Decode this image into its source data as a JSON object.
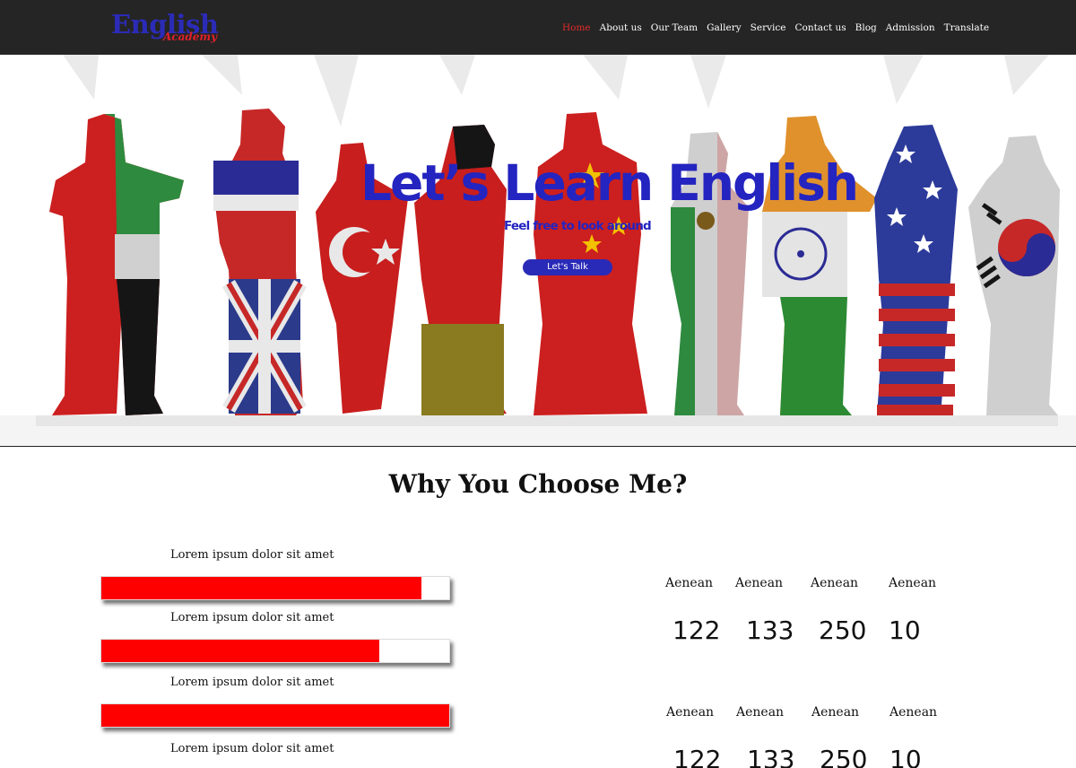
{
  "header": {
    "logo_main": "English",
    "logo_sub": "Academy",
    "nav": [
      {
        "label": "Home",
        "active": true
      },
      {
        "label": "About us"
      },
      {
        "label": "Our Team"
      },
      {
        "label": "Gallery"
      },
      {
        "label": "Service"
      },
      {
        "label": "Contact us"
      },
      {
        "label": "Blog"
      },
      {
        "label": "Admission"
      },
      {
        "label": "Translate"
      }
    ],
    "colors": {
      "bar": "#252525",
      "active": "#e22a2a",
      "logo": "#2b2bb8"
    }
  },
  "hero": {
    "title": "Let’s Learn English",
    "subtitle": "Feel free to look around",
    "cta_label": "Let's Talk",
    "image": "people-in-national-flag-silhouettes"
  },
  "section": {
    "title": "Why You Choose Me?",
    "skills": [
      {
        "label": "Lorem ipsum dolor sit amet",
        "percent": 92
      },
      {
        "label": "Lorem ipsum dolor sit amet",
        "percent": 80
      },
      {
        "label": "Lorem ipsum dolor sit amet",
        "percent": 100
      },
      {
        "label": "Lorem ipsum dolor sit amet"
      }
    ],
    "stats": [
      [
        {
          "label": "Aenean",
          "value": "122"
        },
        {
          "label": "Aenean",
          "value": "133"
        },
        {
          "label": "Aenean",
          "value": "250"
        },
        {
          "label": "Aenean",
          "value": "10"
        }
      ],
      [
        {
          "label": "Aenean",
          "value": "122"
        },
        {
          "label": "Aenean",
          "value": "133"
        },
        {
          "label": "Aenean",
          "value": "250"
        },
        {
          "label": "Aenean",
          "value": "10"
        }
      ]
    ],
    "bar_color": "#ff0000"
  }
}
